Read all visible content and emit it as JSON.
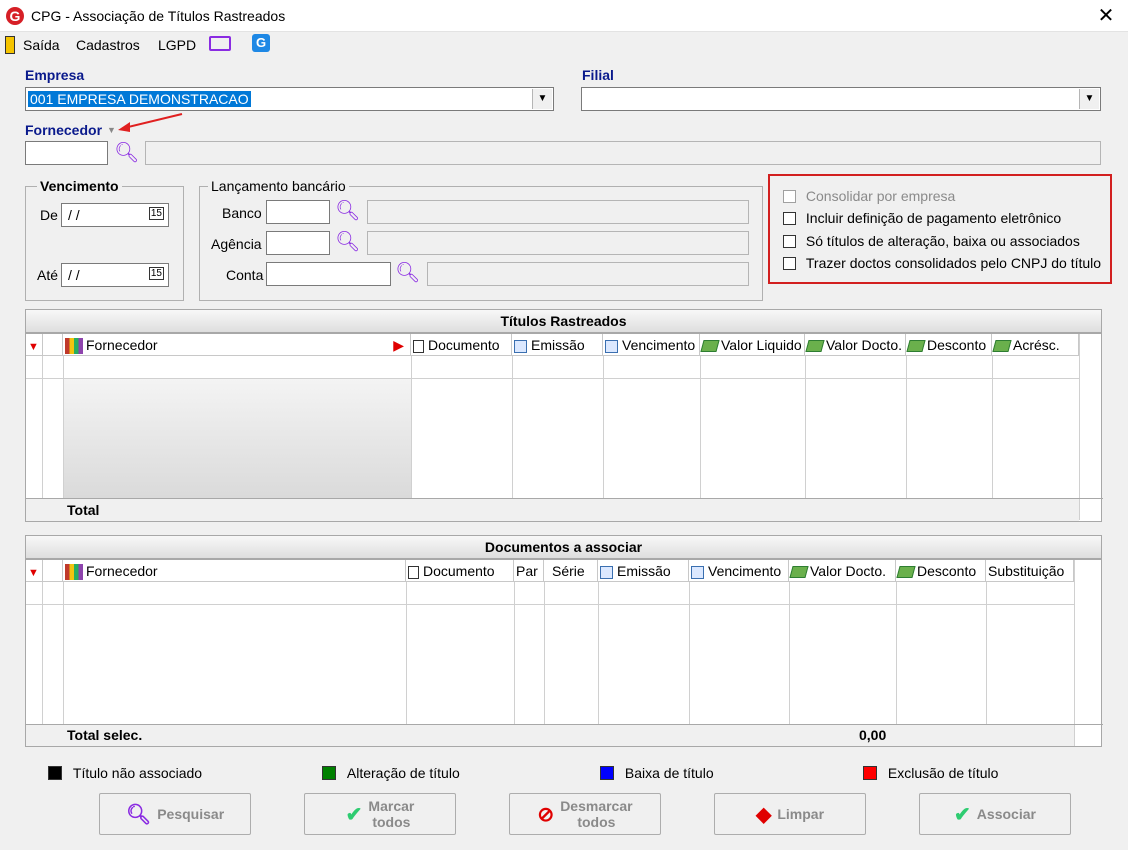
{
  "window": {
    "title": "CPG - Associação de Títulos Rastreados",
    "logo_letter": "G"
  },
  "menu": {
    "items": [
      "Saída",
      "Cadastros",
      "LGPD"
    ]
  },
  "empresa": {
    "label": "Empresa",
    "value": "001 EMPRESA DEMONSTRACAO"
  },
  "filial": {
    "label": "Filial",
    "value": ""
  },
  "fornecedor": {
    "label": "Fornecedor",
    "code": "",
    "name": ""
  },
  "vencimento": {
    "label": "Vencimento",
    "de_label": "De",
    "de_value": " / /",
    "ate_label": "Até",
    "ate_value": " / /",
    "cal_glyph": "15"
  },
  "lancamento": {
    "label": "Lançamento bancário",
    "banco_label": "Banco",
    "agencia_label": "Agência",
    "conta_label": "Conta"
  },
  "options": [
    {
      "label": "Consolidar por empresa",
      "checked": false,
      "disabled": true
    },
    {
      "label": "Incluir definição de pagamento eletrônico",
      "checked": false,
      "disabled": false
    },
    {
      "label": "Só títulos de alteração, baixa ou associados",
      "checked": false,
      "disabled": false
    },
    {
      "label": "Trazer doctos consolidados pelo CNPJ do título",
      "checked": false,
      "disabled": false
    }
  ],
  "titulos_grid": {
    "title": "Títulos Rastreados",
    "columns": [
      "Fornecedor",
      "Documento",
      "Emissão",
      "Vencimento",
      "Valor Liquido",
      "Valor Docto.",
      "Desconto",
      "Acrésc."
    ],
    "total_label": "Total"
  },
  "documentos_grid": {
    "title": "Documentos a associar",
    "columns": [
      "Fornecedor",
      "Documento",
      "Par",
      "Série",
      "Emissão",
      "Vencimento",
      "Valor Docto.",
      "Desconto",
      "Substituição"
    ],
    "total_label": "Total selec.",
    "total_value": "0,00"
  },
  "legend": [
    {
      "label": "Título não associado",
      "color": "#000000"
    },
    {
      "label": "Alteração de título",
      "color": "#008000"
    },
    {
      "label": "Baixa de título",
      "color": "#0000ff"
    },
    {
      "label": "Exclusão de título",
      "color": "#ff0000"
    }
  ],
  "buttons": {
    "pesquisar": "Pesquisar",
    "marcar_l1": "Marcar",
    "marcar_l2": "todos",
    "desmarcar_l1": "Desmarcar",
    "desmarcar_l2": "todos",
    "limpar": "Limpar",
    "associar": "Associar"
  },
  "annotation_color": "#e02020"
}
